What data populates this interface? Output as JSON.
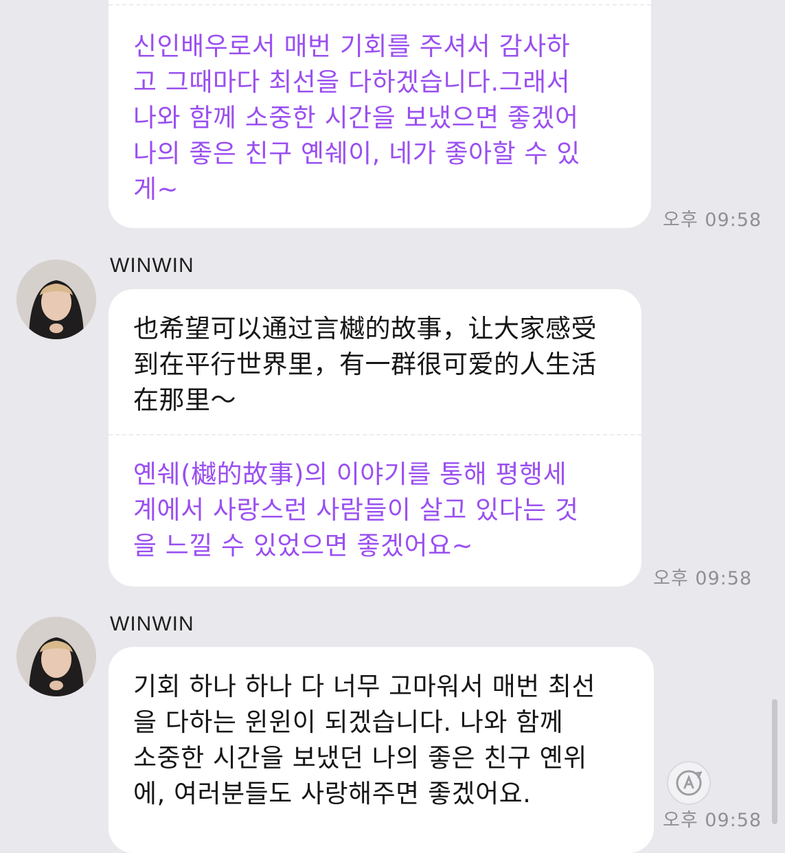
{
  "messages": [
    {
      "translation": "신인배우로서 매번 기회를 주셔서 감사하\n고 그때마다 최선을 다하겠습니다.그래서\n나와 함께 소중한 시간을 보냈으면 좋겠어\n나의 좋은 친구 옌쉐이, 네가 좋아할 수 있\n게~",
      "time": "오후 09:58"
    },
    {
      "sender": "WINWIN",
      "original": "也希望可以通过言樾的故事，让大家感受\n到在平行世界里，有一群很可爱的人生活\n在那里～",
      "translation": "옌쉐(樾的故事)의 이야기를 통해 평행세\n계에서 사랑스런 사람들이 살고 있다는 것\n을 느낄 수 있었으면 좋겠어요~",
      "time": "오후 09:58"
    },
    {
      "sender": "WINWIN",
      "original": "기회 하나 하나 다 너무 고마워서 매번 최선\n을 다하는 윈윈이 되겠습니다. 나와 함께\n소중한 시간을 보냈던 나의 좋은 친구 옌위\n에, 여러분들도 사랑해주면 좋겠어요.",
      "time": "오후 09:58"
    }
  ],
  "icons": {
    "avatar": "profile-photo",
    "fab": "auto-translate-icon"
  },
  "colors": {
    "background": "#e9e8ed",
    "translation_text": "#9a4ff0",
    "bubble": "#ffffff"
  }
}
